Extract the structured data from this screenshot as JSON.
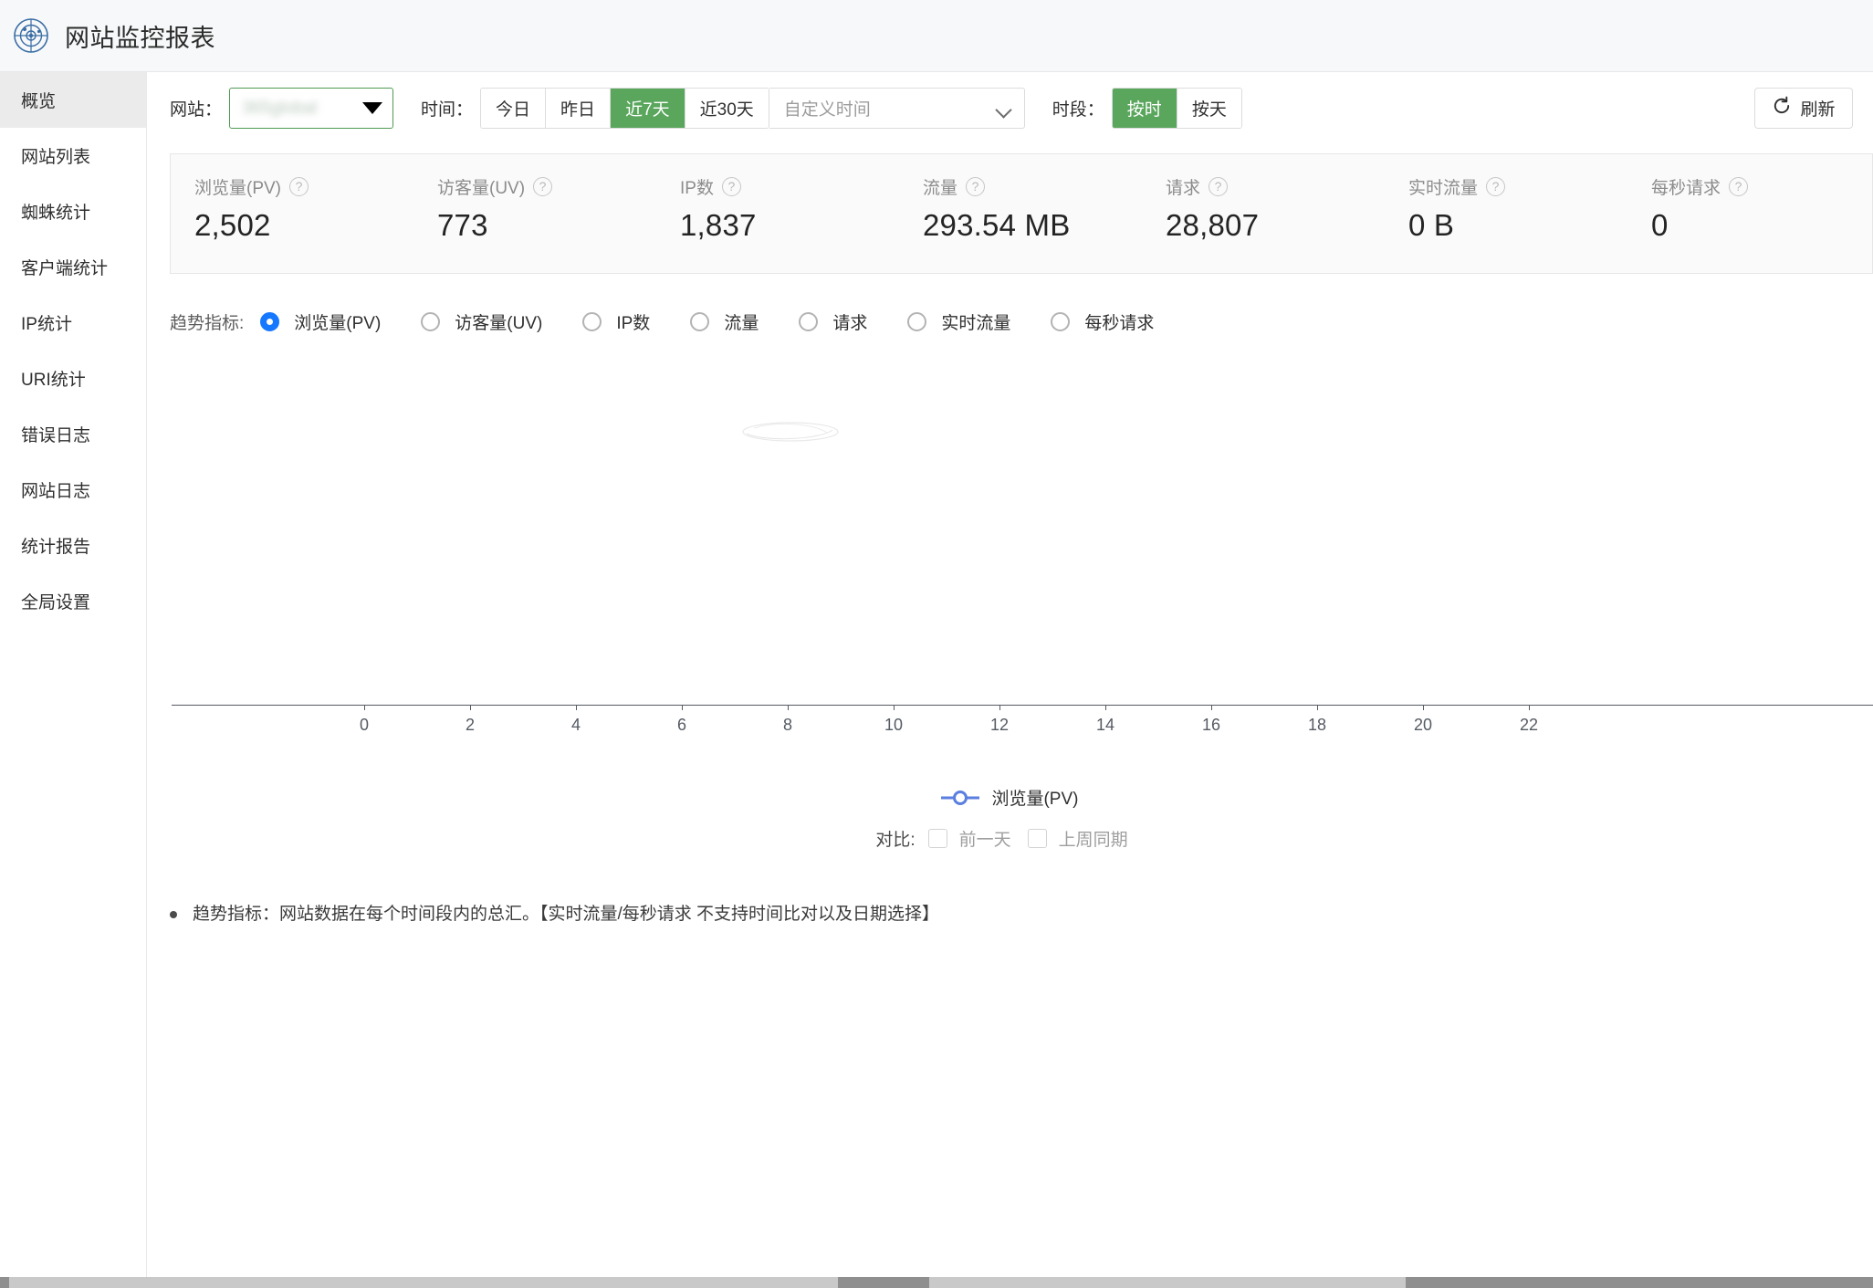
{
  "header": {
    "title": "网站监控报表",
    "logo_icon": "radar-target-icon"
  },
  "sidebar": {
    "items": [
      {
        "label": "概览",
        "active": true
      },
      {
        "label": "网站列表",
        "active": false
      },
      {
        "label": "蜘蛛统计",
        "active": false
      },
      {
        "label": "客户端统计",
        "active": false
      },
      {
        "label": "IP统计",
        "active": false
      },
      {
        "label": "URI统计",
        "active": false
      },
      {
        "label": "错误日志",
        "active": false
      },
      {
        "label": "网站日志",
        "active": false
      },
      {
        "label": "统计报告",
        "active": false
      },
      {
        "label": "全局设置",
        "active": false
      }
    ]
  },
  "toolbar": {
    "site_label": "网站：",
    "site_value": "365global",
    "site_caret_icon": "caret-down-icon",
    "time_label": "时间：",
    "time_options": [
      {
        "label": "今日",
        "active": false
      },
      {
        "label": "昨日",
        "active": false
      },
      {
        "label": "近7天",
        "active": true
      },
      {
        "label": "近30天",
        "active": false
      }
    ],
    "custom_date_placeholder": "自定义时间",
    "custom_date_value": "",
    "custom_date_icon": "chevron-down-icon",
    "period_label": "时段：",
    "period_options": [
      {
        "label": "按时",
        "active": true
      },
      {
        "label": "按天",
        "active": false
      }
    ],
    "refresh_label": "刷新",
    "refresh_icon": "refresh-icon"
  },
  "stats": [
    {
      "label": "浏览量(PV)",
      "value": "2,502",
      "help_icon": "question-circle-icon"
    },
    {
      "label": "访客量(UV)",
      "value": "773",
      "help_icon": "question-circle-icon"
    },
    {
      "label": "IP数",
      "value": "1,837",
      "help_icon": "question-circle-icon"
    },
    {
      "label": "流量",
      "value": "293.54 MB",
      "help_icon": "question-circle-icon"
    },
    {
      "label": "请求",
      "value": "28,807",
      "help_icon": "question-circle-icon"
    },
    {
      "label": "实时流量",
      "value": "0 B",
      "help_icon": "question-circle-icon"
    },
    {
      "label": "每秒请求",
      "value": "0",
      "help_icon": "question-circle-icon"
    }
  ],
  "trend": {
    "label": "趋势指标:",
    "options": [
      {
        "label": "浏览量(PV)",
        "selected": true
      },
      {
        "label": "访客量(UV)",
        "selected": false
      },
      {
        "label": "IP数",
        "selected": false
      },
      {
        "label": "流量",
        "selected": false
      },
      {
        "label": "请求",
        "selected": false
      },
      {
        "label": "实时流量",
        "selected": false
      },
      {
        "label": "每秒请求",
        "selected": false
      }
    ]
  },
  "chart_data": {
    "type": "line",
    "title": "",
    "xlabel": "",
    "ylabel": "",
    "x": [
      0,
      2,
      4,
      6,
      8,
      10,
      12,
      14,
      16,
      18,
      20,
      22
    ],
    "tick_labels": [
      "0",
      "2",
      "4",
      "6",
      "8",
      "10",
      "12",
      "14",
      "16",
      "18",
      "20",
      "22"
    ],
    "xlim": [
      0,
      23
    ],
    "grid": false,
    "legend_position": "bottom",
    "series": [
      {
        "name": "浏览量(PV)",
        "color": "#5b7fe0",
        "values": []
      }
    ],
    "empty": true
  },
  "legend": {
    "label": "浏览量(PV)",
    "color": "#5b7fe0",
    "marker_icon": "line-circle-marker-icon"
  },
  "compare": {
    "label": "对比:",
    "options": [
      {
        "label": "前一天",
        "checked": false
      },
      {
        "label": "上周同期",
        "checked": false
      }
    ]
  },
  "footnote": {
    "text": "趋势指标：网站数据在每个时间段内的总汇。【实时流量/每秒请求 不支持时间比对以及日期选择】"
  }
}
